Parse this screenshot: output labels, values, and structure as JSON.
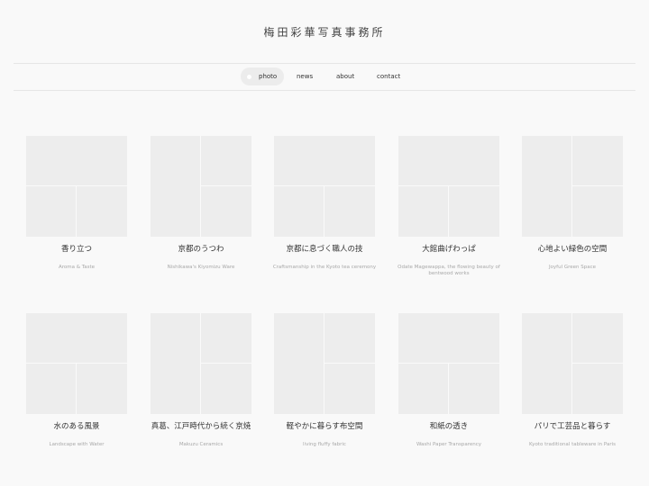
{
  "site": {
    "title": "梅田彩華写真事務所"
  },
  "nav": {
    "items": [
      {
        "label": "photo",
        "active": true
      },
      {
        "label": "news",
        "active": false
      },
      {
        "label": "about",
        "active": false
      },
      {
        "label": "contact",
        "active": false
      }
    ]
  },
  "gallery": {
    "items": [
      {
        "title": "香り立つ",
        "subtitle": "Aroma & Taste"
      },
      {
        "title": "京都のうつわ",
        "subtitle": "Nishikawa's Kiyomizu Ware"
      },
      {
        "title": "京都に息づく職人の技",
        "subtitle": "Craftsmanship in the Kyoto tea ceremony"
      },
      {
        "title": "大館曲げわっぱ",
        "subtitle": "Odate Magewappa, the flowing beauty of bentwood works"
      },
      {
        "title": "心地よい緑色の空間",
        "subtitle": "Joyful Green Space"
      },
      {
        "title": "水のある風景",
        "subtitle": "Landscape with Water"
      },
      {
        "title": "真葛、江戸時代から続く京焼",
        "subtitle": "Makuzu Ceramics"
      },
      {
        "title": "軽やかに暮らす布空間",
        "subtitle": "living fluffy fabric"
      },
      {
        "title": "和紙の透き",
        "subtitle": "Washi Paper Transparency"
      },
      {
        "title": "パリで工芸品と暮らす",
        "subtitle": "Kyoto traditional tableware in Paris"
      }
    ]
  }
}
